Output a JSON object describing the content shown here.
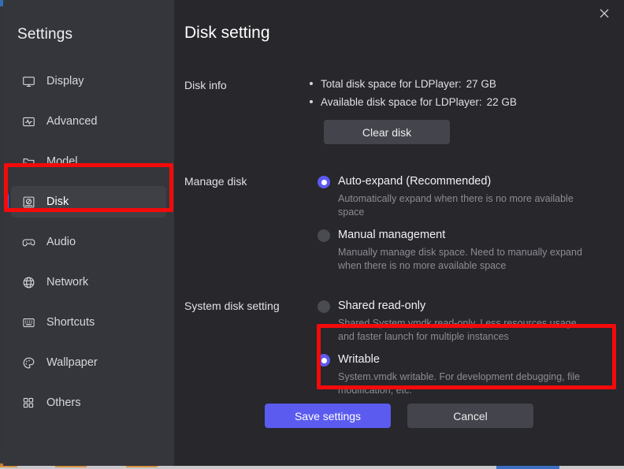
{
  "window": {
    "close_icon": "close-icon"
  },
  "sidebar": {
    "title": "Settings",
    "items": [
      {
        "label": "Display",
        "icon": "monitor-icon",
        "selected": false
      },
      {
        "label": "Advanced",
        "icon": "pulse-icon",
        "selected": false
      },
      {
        "label": "Model",
        "icon": "folder-icon",
        "selected": false
      },
      {
        "label": "Disk",
        "icon": "disk-icon",
        "selected": true
      },
      {
        "label": "Audio",
        "icon": "gamepad-icon",
        "selected": false
      },
      {
        "label": "Network",
        "icon": "globe-icon",
        "selected": false
      },
      {
        "label": "Shortcuts",
        "icon": "keyboard-icon",
        "selected": false
      },
      {
        "label": "Wallpaper",
        "icon": "palette-icon",
        "selected": false
      },
      {
        "label": "Others",
        "icon": "grid-icon",
        "selected": false
      }
    ]
  },
  "main": {
    "title": "Disk setting",
    "disk_info": {
      "label": "Disk info",
      "lines": [
        {
          "text": "Total disk space for LDPlayer:",
          "value": "27 GB"
        },
        {
          "text": "Available disk space for LDPlayer:",
          "value": "22 GB"
        }
      ],
      "clear_button": "Clear disk"
    },
    "manage_disk": {
      "label": "Manage disk",
      "options": [
        {
          "title": "Auto-expand (Recommended)",
          "desc": "Automatically expand when there is no more available space",
          "selected": true
        },
        {
          "title": "Manual management",
          "desc": "Manually manage disk space. Need to manually expand when there is no more available space",
          "selected": false
        }
      ]
    },
    "system_disk_setting": {
      "label": "System disk setting",
      "options": [
        {
          "title": "Shared read-only",
          "desc": "Shared System.vmdk read-only. Less resources usage and faster launch for multiple instances",
          "selected": false
        },
        {
          "title": "Writable",
          "desc": "System.vmdk writable. For development debugging, file modification, etc.",
          "selected": true
        }
      ]
    },
    "footer": {
      "save_label": "Save settings",
      "cancel_label": "Cancel"
    }
  },
  "colors": {
    "accent": "#5b5bf0",
    "highlight": "#f30a0a",
    "sidebar_bg": "#35363b",
    "content_bg": "#27272c"
  }
}
